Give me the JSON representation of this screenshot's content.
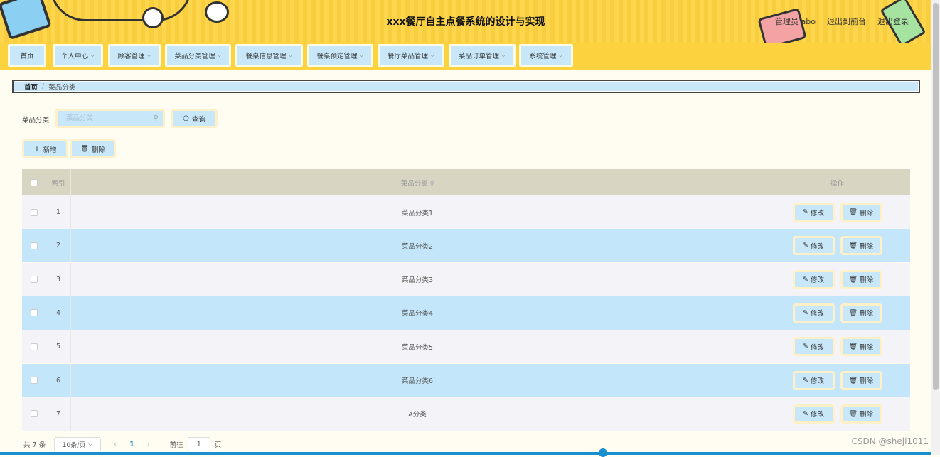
{
  "header": {
    "title": "xxx餐厅自主点餐系统的设计与实现",
    "user": "管理员 abo",
    "to_front": "退出到前台",
    "logout": "退出登录"
  },
  "nav": [
    {
      "label": "首页",
      "dropdown": false
    },
    {
      "label": "个人中心",
      "dropdown": true
    },
    {
      "label": "顾客管理",
      "dropdown": true
    },
    {
      "label": "菜品分类管理",
      "dropdown": true
    },
    {
      "label": "餐桌信息管理",
      "dropdown": true
    },
    {
      "label": "餐桌预定管理",
      "dropdown": true
    },
    {
      "label": "餐厅菜品管理",
      "dropdown": true
    },
    {
      "label": "菜品订单管理",
      "dropdown": true
    },
    {
      "label": "系统管理",
      "dropdown": true
    }
  ],
  "breadcrumb": {
    "home": "首页",
    "separator": "/",
    "current": "菜品分类"
  },
  "search": {
    "label": "菜品分类",
    "placeholder": "菜品分类",
    "query_label": "查询"
  },
  "actions": {
    "add_label": "新增",
    "delete_label": "删除"
  },
  "table": {
    "columns": {
      "index": "索引",
      "name": "菜品分类",
      "operation": "操作"
    },
    "edit_label": "修改",
    "delete_label": "删除",
    "rows": [
      {
        "index": "1",
        "name": "菜品分类1"
      },
      {
        "index": "2",
        "name": "菜品分类2"
      },
      {
        "index": "3",
        "name": "菜品分类3"
      },
      {
        "index": "4",
        "name": "菜品分类4"
      },
      {
        "index": "5",
        "name": "菜品分类5"
      },
      {
        "index": "6",
        "name": "菜品分类6"
      },
      {
        "index": "7",
        "name": "A分类"
      }
    ]
  },
  "pagination": {
    "total": "共 7 条",
    "page_size": "10条/页",
    "current_page": "1",
    "goto_label": "前往",
    "goto_value": "1",
    "page_unit": "页"
  },
  "watermark": "CSDN @sheji1011",
  "colors": {
    "header_bg": "#fdd23f",
    "button_bg": "#c8e8fa",
    "row_alt_bg": "#c4e6fb",
    "row_bg": "#f4f4f8",
    "page_bg": "#fffdf2",
    "thead_bg": "#d9d5c3"
  }
}
